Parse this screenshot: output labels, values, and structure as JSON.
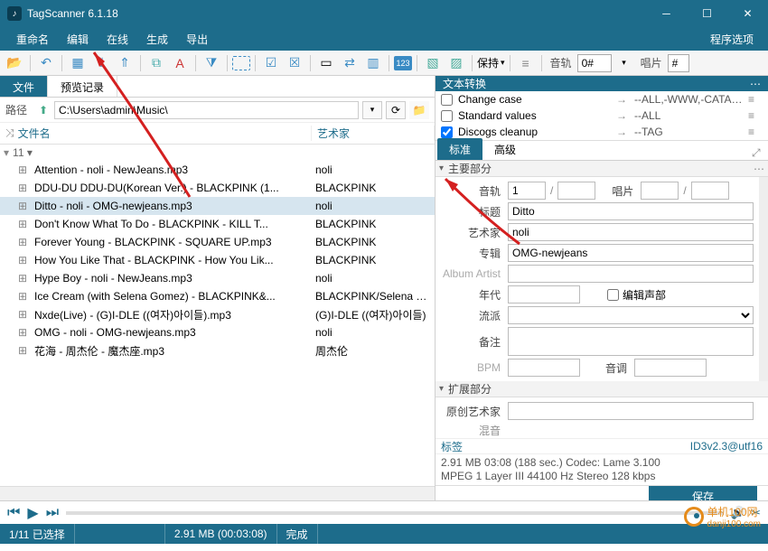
{
  "titlebar": {
    "app_title": "TagScanner 6.1.18"
  },
  "menu": {
    "rename": "重命名",
    "edit": "编辑",
    "online": "在线",
    "generate": "生成",
    "export": "导出",
    "program_options": "程序选项"
  },
  "toolbar": {
    "keep_label": "保持",
    "track_label": "音轨",
    "track_val": "0#",
    "disc_label": "唱片",
    "disc_val": "#"
  },
  "left_tabs": {
    "file": "文件",
    "preview": "预览记录"
  },
  "pathbar": {
    "label": "路径",
    "value": "C:\\Users\\admin\\Music\\"
  },
  "columns": {
    "filename": "文件名",
    "artist": "艺术家"
  },
  "folder_count": "11",
  "files": [
    {
      "name": "Attention - noli - NewJeans.mp3",
      "artist": "noli"
    },
    {
      "name": "DDU-DU DDU-DU(Korean Ver.) - BLACKPINK (1...",
      "artist": "BLACKPINK"
    },
    {
      "name": "Ditto - noli - OMG-newjeans.mp3",
      "artist": "noli",
      "selected": true
    },
    {
      "name": "Don't Know What To Do - BLACKPINK - KILL T...",
      "artist": "BLACKPINK"
    },
    {
      "name": "Forever Young - BLACKPINK - SQUARE UP.mp3",
      "artist": "BLACKPINK"
    },
    {
      "name": "How You Like That - BLACKPINK - How You Lik...",
      "artist": "BLACKPINK"
    },
    {
      "name": "Hype Boy - noli - NewJeans.mp3",
      "artist": "noli"
    },
    {
      "name": "Ice Cream (with Selena Gomez) - BLACKPINK&...",
      "artist": "BLACKPINK/Selena Gome"
    },
    {
      "name": "Nxde(Live) - (G)I-DLE ((여자)아이들).mp3",
      "artist": "(G)I-DLE ((여자)아이들)"
    },
    {
      "name": "OMG - noli - OMG-newjeans.mp3",
      "artist": "noli"
    },
    {
      "name": "花海 - 周杰伦 - 魔杰座.mp3",
      "artist": "周杰伦"
    }
  ],
  "rp_header": {
    "title": "文本转换"
  },
  "transforms": [
    {
      "label": "Change case",
      "value": "--ALL,-WWW,-CATAL...",
      "checked": false
    },
    {
      "label": "Standard values",
      "value": "--ALL",
      "checked": false
    },
    {
      "label": "Discogs cleanup",
      "value": "--TAG",
      "checked": true
    }
  ],
  "subtabs": {
    "standard": "标准",
    "advanced": "高级"
  },
  "sections": {
    "main": "主要部分",
    "extended": "扩展部分"
  },
  "form": {
    "track_lbl": "音轨",
    "track_val": "1",
    "disc_lbl": "唱片",
    "title_lbl": "标题",
    "title_val": "Ditto",
    "artist_lbl": "艺术家",
    "artist_val": "noli",
    "album_lbl": "专辑",
    "album_val": "OMG-newjeans",
    "albumartist_lbl": "Album Artist",
    "year_lbl": "年代",
    "edit_voice_lbl": "编辑声部",
    "genre_lbl": "流派",
    "comment_lbl": "备注",
    "bpm_lbl": "BPM",
    "key_lbl": "音调",
    "origartist_lbl": "原创艺术家",
    "mix_lbl": "混音"
  },
  "taginfo": {
    "left": "标签",
    "right": "ID3v2.3@utf16"
  },
  "codec": {
    "line1": "2.91 MB  03:08 (188 sec.)  Codec: Lame 3.100",
    "line2": "MPEG 1 Layer III  44100 Hz  Stereo  128 kbps"
  },
  "save_label": "保存",
  "statusbar": {
    "selection": "1/11 已选择",
    "size": "2.91 MB (00:03:08)",
    "done": "完成"
  },
  "watermark": {
    "text1": "单机100网",
    "text2": "danji100.com"
  }
}
